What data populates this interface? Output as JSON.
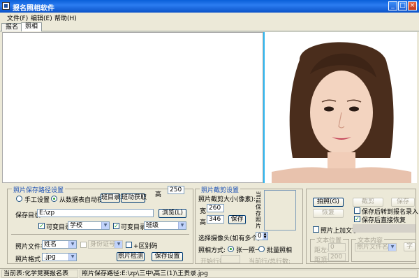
{
  "window": {
    "title": "报名照相软件"
  },
  "menu": {
    "file": "文件(F)",
    "edit": "编辑(E)",
    "help": "帮助(H)"
  },
  "tabs": [
    "报名",
    "照相"
  ],
  "path_group": {
    "title": "照片保存路径设置",
    "manual": "手工设置",
    "auto": "从数据表自动获取",
    "class_dir": "班目录2",
    "class_fetch": "班动获取",
    "height_label": "高",
    "height_value": "250",
    "save_dir_label": "保存目录",
    "save_dir_value": "E:\\zp",
    "browse": "浏览(L)",
    "subdir1_label": "可变目录1",
    "subdir1_value": "学校",
    "subdir2_label": "可变目录2",
    "subdir2_value": "班级",
    "filename_label": "照片文件名",
    "filename_value": "姓名",
    "idcard_value": "身份证号",
    "serial_label": "+区别码",
    "format_label": "照片格式",
    "format_value": ".jpg",
    "detect": "照片检测",
    "save_settings": "保存设置"
  },
  "crop_group": {
    "title": "照片截剪设置",
    "size_label": "照片截剪大小(像素):",
    "width_label": "宽",
    "width_value": "260",
    "height_label": "高",
    "height_value": "346",
    "save": "保存",
    "preview_label": "当前保存照片",
    "camera_label": "选择摄像头(如有多个):",
    "camera_value": "0",
    "mode_label": "照相方式:",
    "mode_one": "张一照一",
    "mode_batch": "批量照相",
    "start_label": "开始行数:",
    "current_label": "当前行/总行数:"
  },
  "actions": {
    "shoot": "拍照(G)",
    "crop": "截剪",
    "save": "保存",
    "restore": "恢复",
    "auto_next": "保存后转到报名录入",
    "auto_restore": "保存后直接恢复",
    "add_text": "照片上加文字",
    "text_pos": "文本位置",
    "text_content": "文本内容",
    "left_label": "距左:",
    "left_value": "0",
    "top_label": "距顶:",
    "top_value": "200",
    "text_field": "照片文件名",
    "font_btn": "字"
  },
  "status": {
    "table": "当前表:化学竞赛报名表",
    "path": "照片保存路径:E:\\zp\\三中\\高三(1)\\王贵录.jpg"
  },
  "colors": {
    "title_bar": "#0a5fd8",
    "accent_border": "#2eb6f0",
    "group_title": "#1a4fb4"
  }
}
